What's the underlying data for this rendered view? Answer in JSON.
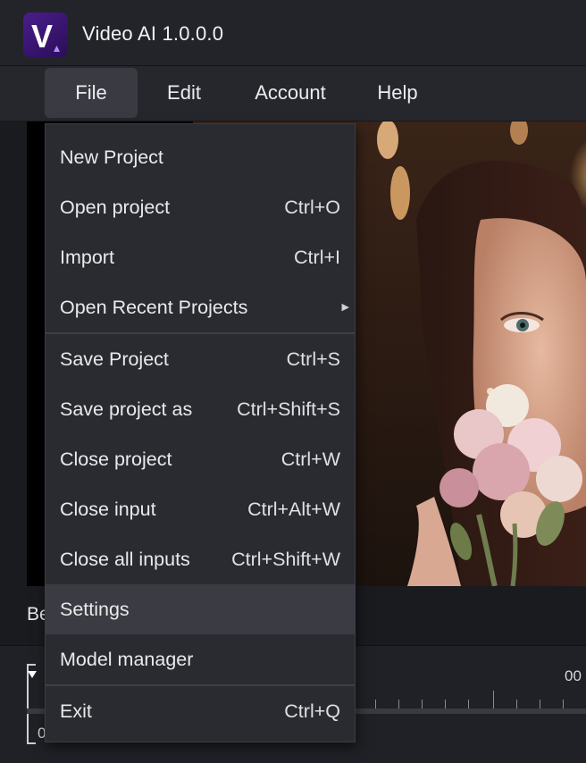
{
  "window": {
    "title": "Video AI 1.0.0.0",
    "logo_letter": "V",
    "colors": {
      "accent": "#5b2aa8",
      "menu_bg": "#2a2b30",
      "highlight": "#3b3c43"
    }
  },
  "menubar": {
    "items": [
      {
        "label": "File",
        "active": true
      },
      {
        "label": "Edit",
        "active": false
      },
      {
        "label": "Account",
        "active": false
      },
      {
        "label": "Help",
        "active": false
      }
    ]
  },
  "file_menu": {
    "items": [
      {
        "label": "New Project",
        "shortcut": ""
      },
      {
        "label": "Open project",
        "shortcut": "Ctrl+O"
      },
      {
        "label": "Import",
        "shortcut": "Ctrl+I"
      },
      {
        "label": "Open Recent Projects",
        "shortcut": "",
        "submenu_icon": "chevron-right-icon"
      },
      {
        "label": "Save Project",
        "shortcut": "Ctrl+S"
      },
      {
        "label": "Save project as",
        "shortcut": "Ctrl+Shift+S"
      },
      {
        "label": "Close project",
        "shortcut": "Ctrl+W"
      },
      {
        "label": "Close input",
        "shortcut": "Ctrl+Alt+W"
      },
      {
        "label": "Close all inputs",
        "shortcut": "Ctrl+Shift+W"
      },
      {
        "label": "Settings",
        "shortcut": "",
        "highlighted": true
      },
      {
        "label": "Model manager",
        "shortcut": ""
      },
      {
        "label": "Exit",
        "shortcut": "Ctrl+Q"
      }
    ]
  },
  "preview": {
    "label_partial": "Be"
  },
  "timeline": {
    "start_label": "0",
    "time_label_partial": "00"
  }
}
